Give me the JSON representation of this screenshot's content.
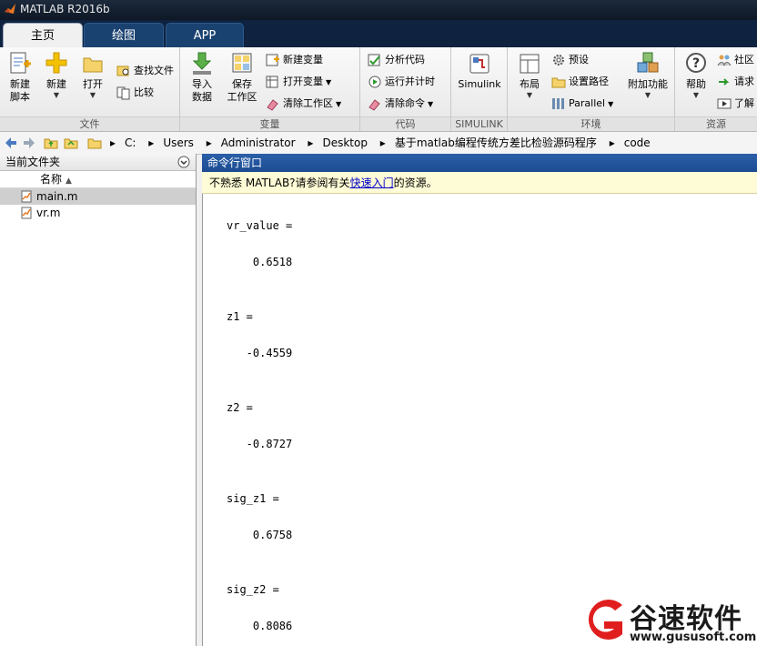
{
  "window": {
    "title": "MATLAB R2016b"
  },
  "tabs": [
    {
      "label": "主页",
      "active": true
    },
    {
      "label": "绘图",
      "active": false
    },
    {
      "label": "APP",
      "active": false
    }
  ],
  "ribbon": {
    "file": {
      "group_label": "文件",
      "new_script": "新建\n脚本",
      "new": "新建",
      "open": "打开",
      "find_files": "查找文件",
      "compare": "比较"
    },
    "variable": {
      "group_label": "变量",
      "import_data": "导入\n数据",
      "save_workspace": "保存\n工作区",
      "new_variable": "新建变量",
      "open_variable": "打开变量",
      "clear_workspace": "清除工作区"
    },
    "code": {
      "group_label": "代码",
      "analyze_code": "分析代码",
      "run_and_time": "运行并计时",
      "clear_commands": "清除命令"
    },
    "simulink": {
      "group_label": "SIMULINK",
      "simulink": "Simulink"
    },
    "environment": {
      "group_label": "环境",
      "layout": "布局",
      "preferences": "预设",
      "set_path": "设置路径",
      "parallel": "Parallel",
      "addons": "附加功能"
    },
    "resources": {
      "group_label": "资源",
      "help": "帮助",
      "community": "社区",
      "request_support": "请求",
      "learn": "了解"
    }
  },
  "address": {
    "path": [
      "C:",
      "Users",
      "Administrator",
      "Desktop",
      "基于matlab编程传统方差比检验源码程序",
      "code"
    ]
  },
  "left_panel": {
    "title": "当前文件夹",
    "column_name": "名称",
    "files": [
      {
        "name": "main.m",
        "selected": true
      },
      {
        "name": "vr.m",
        "selected": false
      }
    ]
  },
  "command_window": {
    "title": "命令行窗口",
    "info_prefix": "不熟悉 MATLAB?请参阅有关",
    "info_link": "快速入门",
    "info_suffix": "的资源。",
    "outputs": [
      {
        "label": "vr_value =",
        "value": "    0.6518"
      },
      {
        "label": "z1 =",
        "value": "   -0.4559"
      },
      {
        "label": "z2 =",
        "value": "   -0.8727"
      },
      {
        "label": "sig_z1 =",
        "value": "    0.6758"
      },
      {
        "label": "sig_z2 =",
        "value": "    0.8086"
      }
    ]
  },
  "watermark": {
    "brand": "谷速软件",
    "url": "www.gususoft.com"
  },
  "colors": {
    "accent": "#1d4c92",
    "tab_bg": "#1a4270",
    "titlebar": "#0e1826",
    "watermark_red": "#e01e1e"
  }
}
